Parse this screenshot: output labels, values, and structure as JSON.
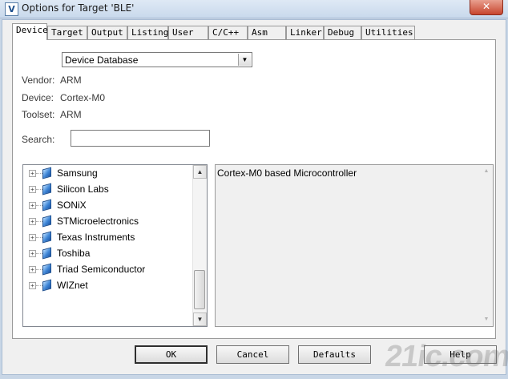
{
  "window": {
    "title": "Options for Target 'BLE'",
    "close_glyph": "✕",
    "icon_glyph": "V"
  },
  "tabs": [
    {
      "label": "Device",
      "active": true
    },
    {
      "label": "Target"
    },
    {
      "label": "Output"
    },
    {
      "label": "Listing"
    },
    {
      "label": "User"
    },
    {
      "label": "C/C++"
    },
    {
      "label": "Asm"
    },
    {
      "label": "Linker"
    },
    {
      "label": "Debug"
    },
    {
      "label": "Utilities"
    }
  ],
  "device_tab": {
    "database_select": "Device Database",
    "vendor": {
      "label": "Vendor:",
      "value": "ARM"
    },
    "device": {
      "label": "Device:",
      "value": "Cortex-M0"
    },
    "toolset": {
      "label": "Toolset:",
      "value": "ARM"
    },
    "search": {
      "label": "Search:",
      "value": ""
    },
    "tree_items": [
      "Samsung",
      "Silicon Labs",
      "SONiX",
      "STMicroelectronics",
      "Texas Instruments",
      "Toshiba",
      "Triad Semiconductor",
      "WIZnet"
    ],
    "description": "Cortex-M0 based Microcontroller"
  },
  "buttons": {
    "ok": "OK",
    "cancel": "Cancel",
    "defaults": "Defaults",
    "help": "Help"
  },
  "glyphs": {
    "expand": "+",
    "arrow_up": "▲",
    "arrow_down": "▼"
  },
  "watermark": "21ic.com",
  "colors": {
    "titlebar": "#c9d9ec",
    "close": "#c7452e",
    "dialog_bg": "#f0f0f0"
  },
  "icons": {
    "app": "keil-uvision-icon",
    "vendor": "vendor-chip-icon"
  }
}
